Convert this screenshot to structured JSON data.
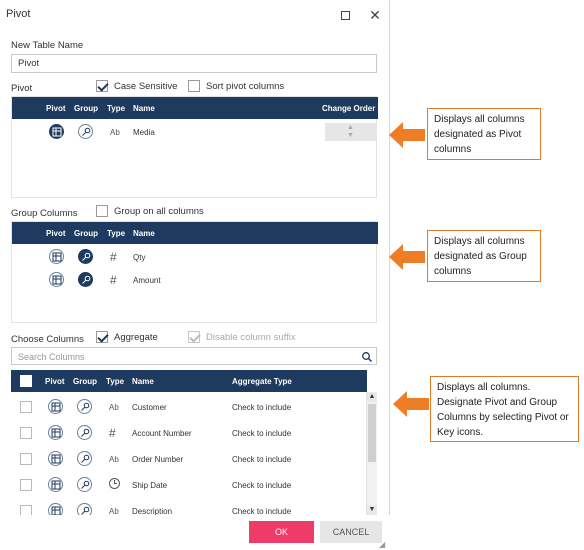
{
  "window": {
    "title": "Pivot",
    "maximize_icon": "maximize-icon",
    "close_icon": "close-icon"
  },
  "new_table": {
    "label": "New Table Name",
    "value": "Pivot"
  },
  "pivot_section": {
    "label": "Pivot",
    "case_sensitive": {
      "label": "Case Sensitive",
      "checked": true
    },
    "sort_pivot": {
      "label": "Sort pivot columns",
      "checked": false
    },
    "columns": {
      "pivot": "Pivot",
      "group": "Group",
      "type": "Type",
      "name": "Name",
      "change_order": "Change Order"
    },
    "rows": [
      {
        "type": "Ab",
        "name": "Media"
      }
    ]
  },
  "group_section": {
    "label": "Group Columns",
    "group_all": {
      "label": "Group on all columns",
      "checked": false
    },
    "columns": {
      "pivot": "Pivot",
      "group": "Group",
      "type": "Type",
      "name": "Name"
    },
    "rows": [
      {
        "type": "#",
        "name": "Qty"
      },
      {
        "type": "#",
        "name": "Amount"
      }
    ]
  },
  "choose_section": {
    "label": "Choose Columns",
    "aggregate": {
      "label": "Aggregate",
      "checked": true
    },
    "disable_suffix": {
      "label": "Disable column suffix",
      "checked": true,
      "disabled": true
    },
    "search_placeholder": "Search Columns",
    "columns": {
      "pivot": "Pivot",
      "group": "Group",
      "type": "Type",
      "name": "Name",
      "aggregate_type": "Aggregate Type"
    },
    "rows": [
      {
        "type": "Ab",
        "name": "Customer",
        "aggregate": "Check to include"
      },
      {
        "type": "#",
        "name": "Account Number",
        "aggregate": "Check to include"
      },
      {
        "type": "Ab",
        "name": "Order Number",
        "aggregate": "Check to include"
      },
      {
        "type": "clock",
        "name": "Ship Date",
        "aggregate": "Check to include"
      },
      {
        "type": "Ab",
        "name": "Description",
        "aggregate": "Check to include"
      }
    ]
  },
  "footer": {
    "ok": "OK",
    "cancel": "CANCEL"
  },
  "callouts": [
    {
      "text": "Displays all columns designated as Pivot columns"
    },
    {
      "text": "Displays all columns designated as Group columns"
    },
    {
      "text": "Displays all columns. Designate Pivot and Group Columns by selecting Pivot or Key icons."
    }
  ],
  "colors": {
    "header": "#1e3a5f",
    "ok_button": "#ee3b6a",
    "callout_border": "#e07b2a",
    "arrow": "#ef7d26"
  }
}
